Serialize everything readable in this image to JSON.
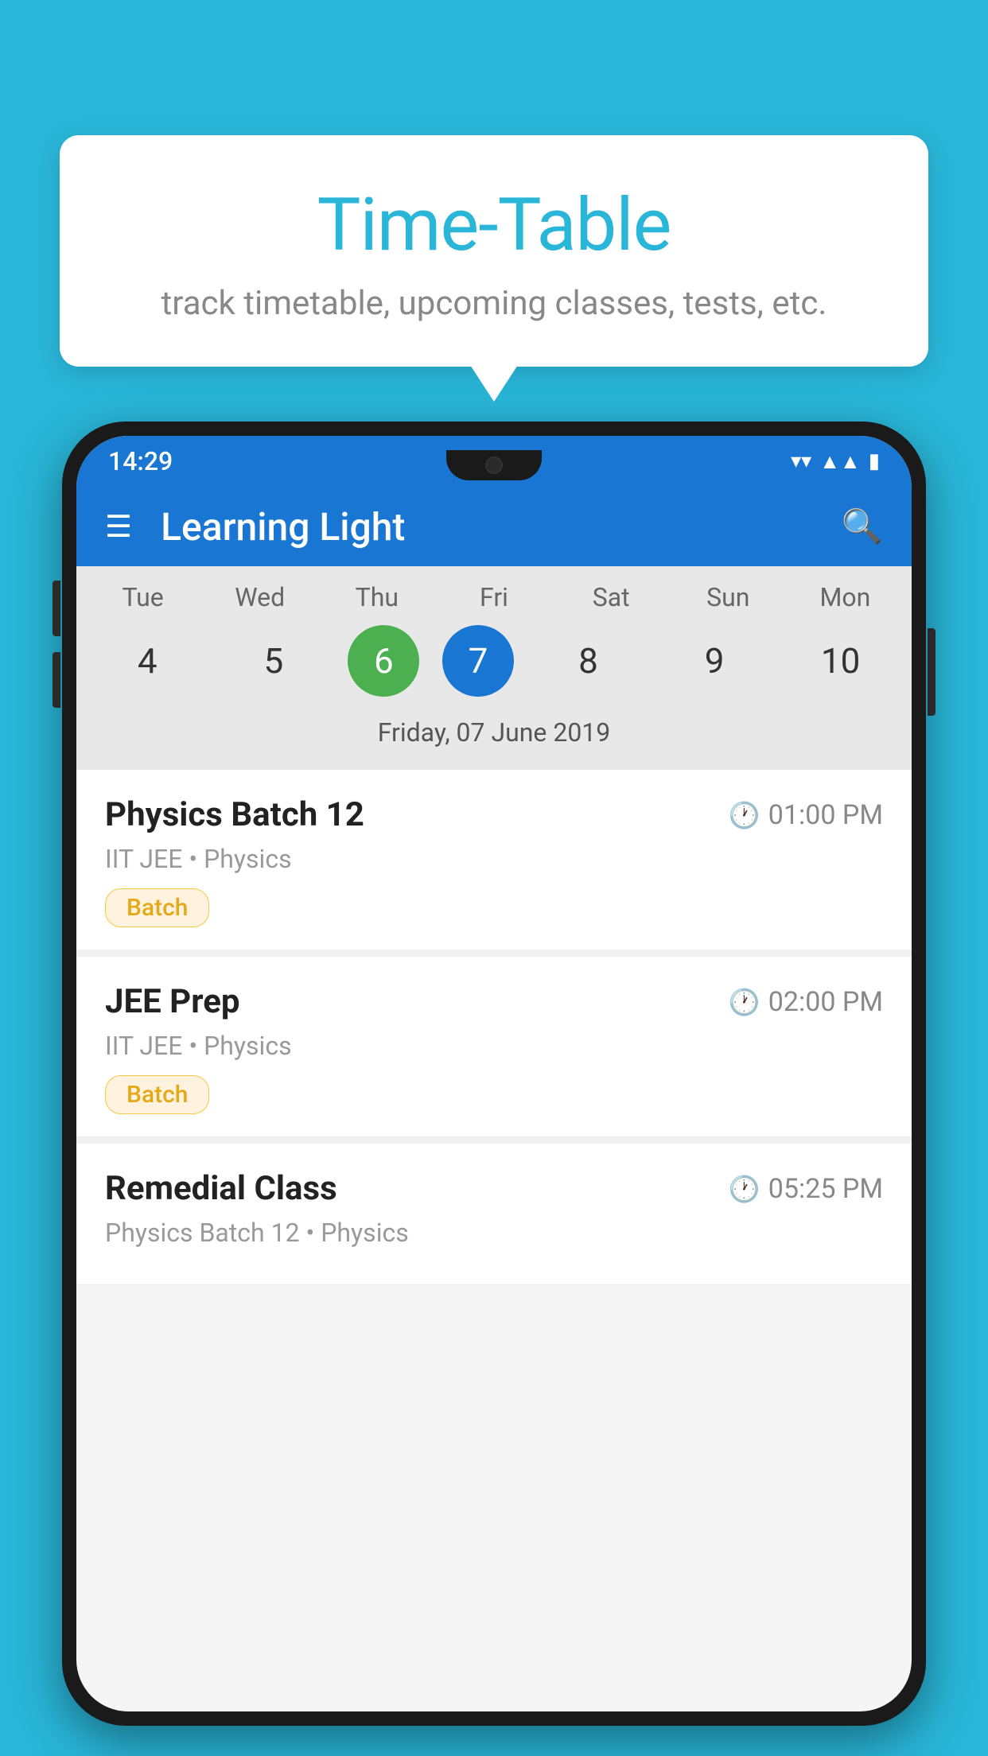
{
  "background_color": "#29B6D8",
  "speech_bubble": {
    "title": "Time-Table",
    "subtitle": "track timetable, upcoming classes, tests, etc."
  },
  "phone": {
    "status_bar": {
      "time": "14:29",
      "icons": [
        "wifi",
        "signal",
        "battery"
      ]
    },
    "app_bar": {
      "title": "Learning Light",
      "hamburger_label": "☰",
      "search_label": "🔍"
    },
    "calendar": {
      "days": [
        {
          "name": "Tue",
          "number": "4"
        },
        {
          "name": "Wed",
          "number": "5"
        },
        {
          "name": "Thu",
          "number": "6",
          "state": "today"
        },
        {
          "name": "Fri",
          "number": "7",
          "state": "selected"
        },
        {
          "name": "Sat",
          "number": "8"
        },
        {
          "name": "Sun",
          "number": "9"
        },
        {
          "name": "Mon",
          "number": "10"
        }
      ],
      "selected_date": "Friday, 07 June 2019"
    },
    "schedule": [
      {
        "title": "Physics Batch 12",
        "time": "01:00 PM",
        "subtitle": "IIT JEE • Physics",
        "badge": "Batch"
      },
      {
        "title": "JEE Prep",
        "time": "02:00 PM",
        "subtitle": "IIT JEE • Physics",
        "badge": "Batch"
      },
      {
        "title": "Remedial Class",
        "time": "05:25 PM",
        "subtitle": "Physics Batch 12 • Physics",
        "badge": ""
      }
    ]
  }
}
